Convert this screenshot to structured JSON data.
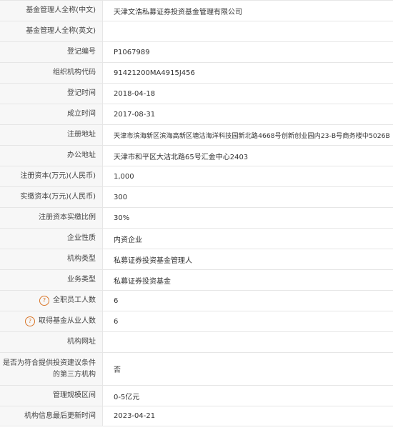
{
  "rows": [
    {
      "label": "基金管理人全称(中文)",
      "value": "天津文浩私募证券投资基金管理有限公司"
    },
    {
      "label": "基金管理人全称(英文)",
      "value": ""
    },
    {
      "label": "登记编号",
      "value": "P1067989"
    },
    {
      "label": "组织机构代码",
      "value": "91421200MA4915J456"
    },
    {
      "label": "登记时间",
      "value": "2018-04-18"
    },
    {
      "label": "成立时间",
      "value": "2017-08-31"
    },
    {
      "label": "注册地址",
      "value": "天津市滨海新区滨海高新区塘沽海洋科技园新北路4668号创新创业园内23-B号商务楼中5026B"
    },
    {
      "label": "办公地址",
      "value": "天津市和平区大沽北路65号汇金中心2403"
    },
    {
      "label": "注册资本(万元)(人民币)",
      "value": "1,000"
    },
    {
      "label": "实缴资本(万元)(人民币)",
      "value": "300"
    },
    {
      "label": "注册资本实缴比例",
      "value": "30%"
    },
    {
      "label": "企业性质",
      "value": "内资企业"
    },
    {
      "label": "机构类型",
      "value": "私募证券投资基金管理人"
    },
    {
      "label": "业务类型",
      "value": "私募证券投资基金"
    },
    {
      "label": "全职员工人数",
      "value": "6",
      "help_icon": "?"
    },
    {
      "label": "取得基金从业人数",
      "value": "6",
      "help_icon": "?"
    },
    {
      "label": "机构网址",
      "value": ""
    },
    {
      "label_line1": "是否为符合提供投资建议条件",
      "label_line2": "的第三方机构",
      "value": "否"
    },
    {
      "label": "管理规模区间",
      "value": "0-5亿元"
    },
    {
      "label": "机构信息最后更新时间",
      "value": "2023-04-21"
    }
  ],
  "colors": {
    "label_bg": "#f7f7f7",
    "border": "#e6e6e6",
    "help_icon": "#d9772b"
  },
  "icons": {
    "help": "question-circle-icon"
  }
}
